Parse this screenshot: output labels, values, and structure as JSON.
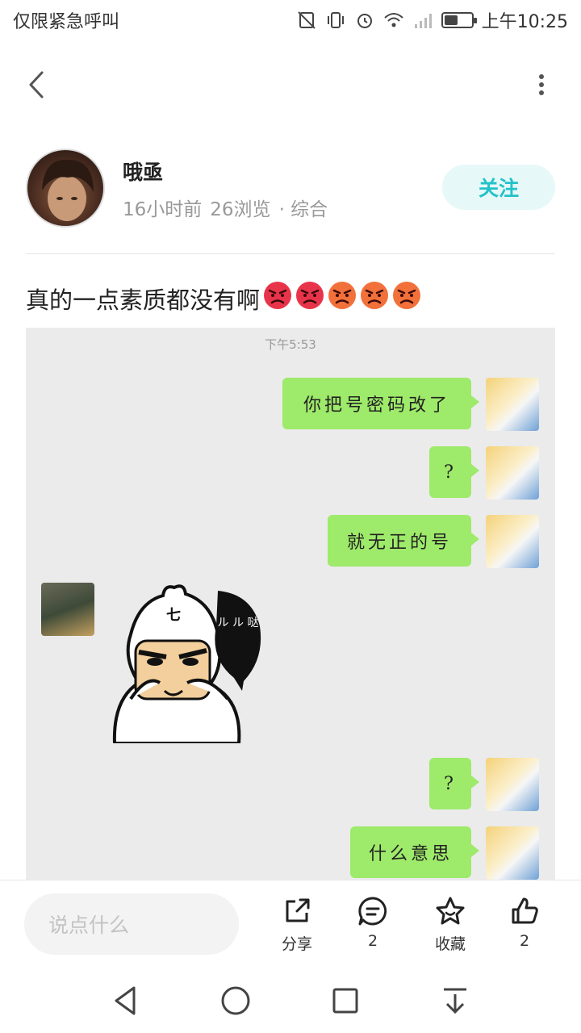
{
  "status_bar": {
    "left_text": "仅限紧急呼叫",
    "time": "上午10:25",
    "battery_level": 0.5
  },
  "nav": {
    "back_icon": "chevron-left-icon",
    "more_icon": "more-vertical-icon"
  },
  "author": {
    "name": "哦亟",
    "time_ago": "16小时前",
    "views": "26浏览",
    "category": "· 综合",
    "follow_label": "关注"
  },
  "post": {
    "title": "真的一点素质都没有啊",
    "emoji_count": 5,
    "image": {
      "time_label": "下午5:53",
      "messages": [
        {
          "side": "me",
          "text": "你把号密码改了"
        },
        {
          "side": "me",
          "text": "?"
        },
        {
          "side": "me",
          "text": "就无正的号"
        },
        {
          "side": "other",
          "sticker_text": "ル ル 哒",
          "sticker_badge": "七"
        },
        {
          "side": "me",
          "text": "?"
        },
        {
          "side": "me",
          "text": "什么意思"
        }
      ]
    }
  },
  "bottom_bar": {
    "comment_placeholder": "说点什么",
    "share_label": "分享",
    "comment_count": "2",
    "favorite_label": "收藏",
    "like_count": "2"
  },
  "colors": {
    "accent": "#22c2c8",
    "follow_bg": "#e6f8f8",
    "bubble_green": "#9eea6a"
  }
}
